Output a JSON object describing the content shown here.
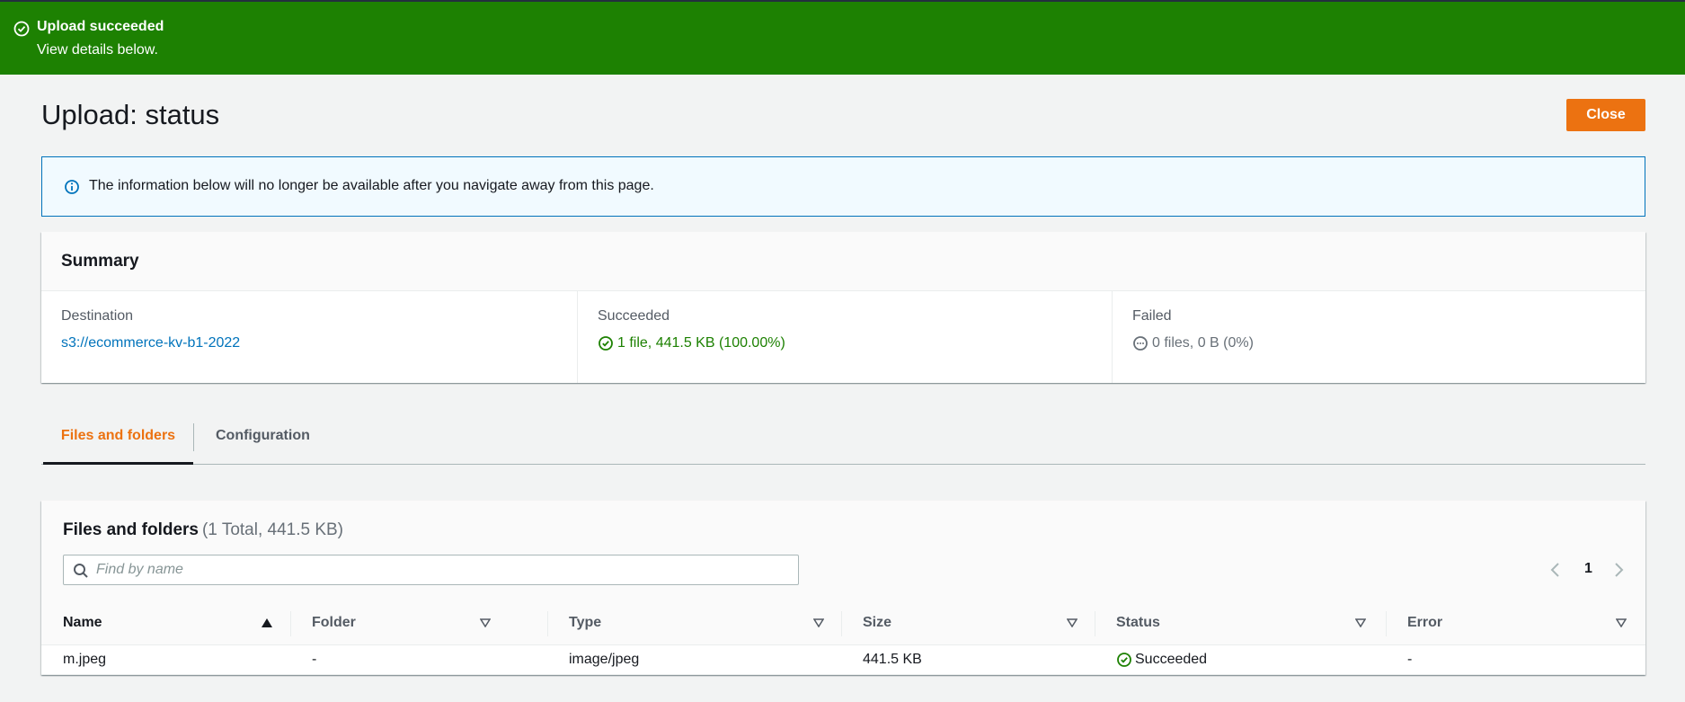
{
  "flash": {
    "title": "Upload succeeded",
    "message": "View details below.",
    "icon": "check-circle-icon"
  },
  "header": {
    "title": "Upload: status",
    "close_label": "Close"
  },
  "info_alert": {
    "text": "The information below will no longer be available after you navigate away from this page.",
    "icon": "info-icon"
  },
  "summary": {
    "title": "Summary",
    "destination": {
      "label": "Destination",
      "value": "s3://ecommerce-kv-b1-2022"
    },
    "succeeded": {
      "label": "Succeeded",
      "value": "1 file, 441.5 KB (100.00%)"
    },
    "failed": {
      "label": "Failed",
      "value": "0 files, 0 B (0%)"
    }
  },
  "tabs": [
    {
      "label": "Files and folders",
      "active": true
    },
    {
      "label": "Configuration",
      "active": false
    }
  ],
  "files": {
    "title": "Files and folders",
    "count": "(1 Total, 441.5 KB)",
    "search_placeholder": "Find by name",
    "page": "1",
    "columns": [
      "Name",
      "Folder",
      "Type",
      "Size",
      "Status",
      "Error"
    ],
    "rows": [
      {
        "name": "m.jpeg",
        "folder": "-",
        "type": "image/jpeg",
        "size": "441.5 KB",
        "status": "Succeeded",
        "error": "-"
      }
    ]
  },
  "colors": {
    "success": "#1d8102",
    "accent": "#ec7211",
    "link": "#0073bb",
    "info_border": "#0073bb"
  }
}
